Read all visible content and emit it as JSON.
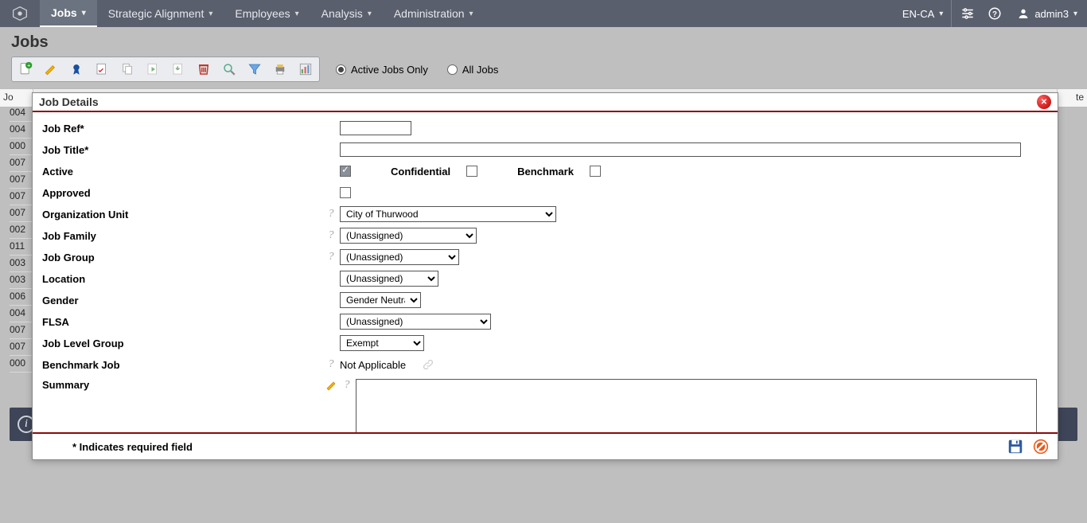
{
  "topnav": {
    "tabs": [
      {
        "label": "Jobs",
        "active": true
      },
      {
        "label": "Strategic Alignment",
        "active": false
      },
      {
        "label": "Employees",
        "active": false
      },
      {
        "label": "Analysis",
        "active": false
      },
      {
        "label": "Administration",
        "active": false
      }
    ],
    "locale": "EN-CA",
    "user": "admin3"
  },
  "page": {
    "title": "Jobs"
  },
  "filters": {
    "active_only": "Active Jobs Only",
    "all_jobs": "All Jobs",
    "selected": "active"
  },
  "grid": {
    "col_jobref": "Jo",
    "col_far_right": "te",
    "jobrefs": [
      "004",
      "004",
      "000",
      "007",
      "007",
      "007",
      "007",
      "002",
      "011",
      "003",
      "003",
      "006",
      "004",
      "007",
      "007",
      "000"
    ]
  },
  "modal": {
    "title": "Job Details",
    "labels": {
      "job_ref": "Job Ref*",
      "job_title": "Job Title*",
      "active": "Active",
      "confidential": "Confidential",
      "benchmark": "Benchmark",
      "approved": "Approved",
      "org_unit": "Organization Unit",
      "job_family": "Job Family",
      "job_group": "Job Group",
      "location": "Location",
      "gender": "Gender",
      "flsa": "FLSA",
      "job_level_group": "Job Level Group",
      "benchmark_job": "Benchmark Job",
      "summary": "Summary"
    },
    "values": {
      "job_ref": "",
      "job_title": "",
      "active_checked": true,
      "confidential_checked": false,
      "benchmark_checked": false,
      "approved_checked": false,
      "org_unit": "City of Thurwood",
      "job_family": "(Unassigned)",
      "job_group": "(Unassigned)",
      "location": "(Unassigned)",
      "gender": "Gender Neutral",
      "flsa": "(Unassigned)",
      "job_level_group": "Exempt",
      "benchmark_job": "Not Applicable",
      "summary": ""
    },
    "footer_note": "* Indicates required field"
  }
}
